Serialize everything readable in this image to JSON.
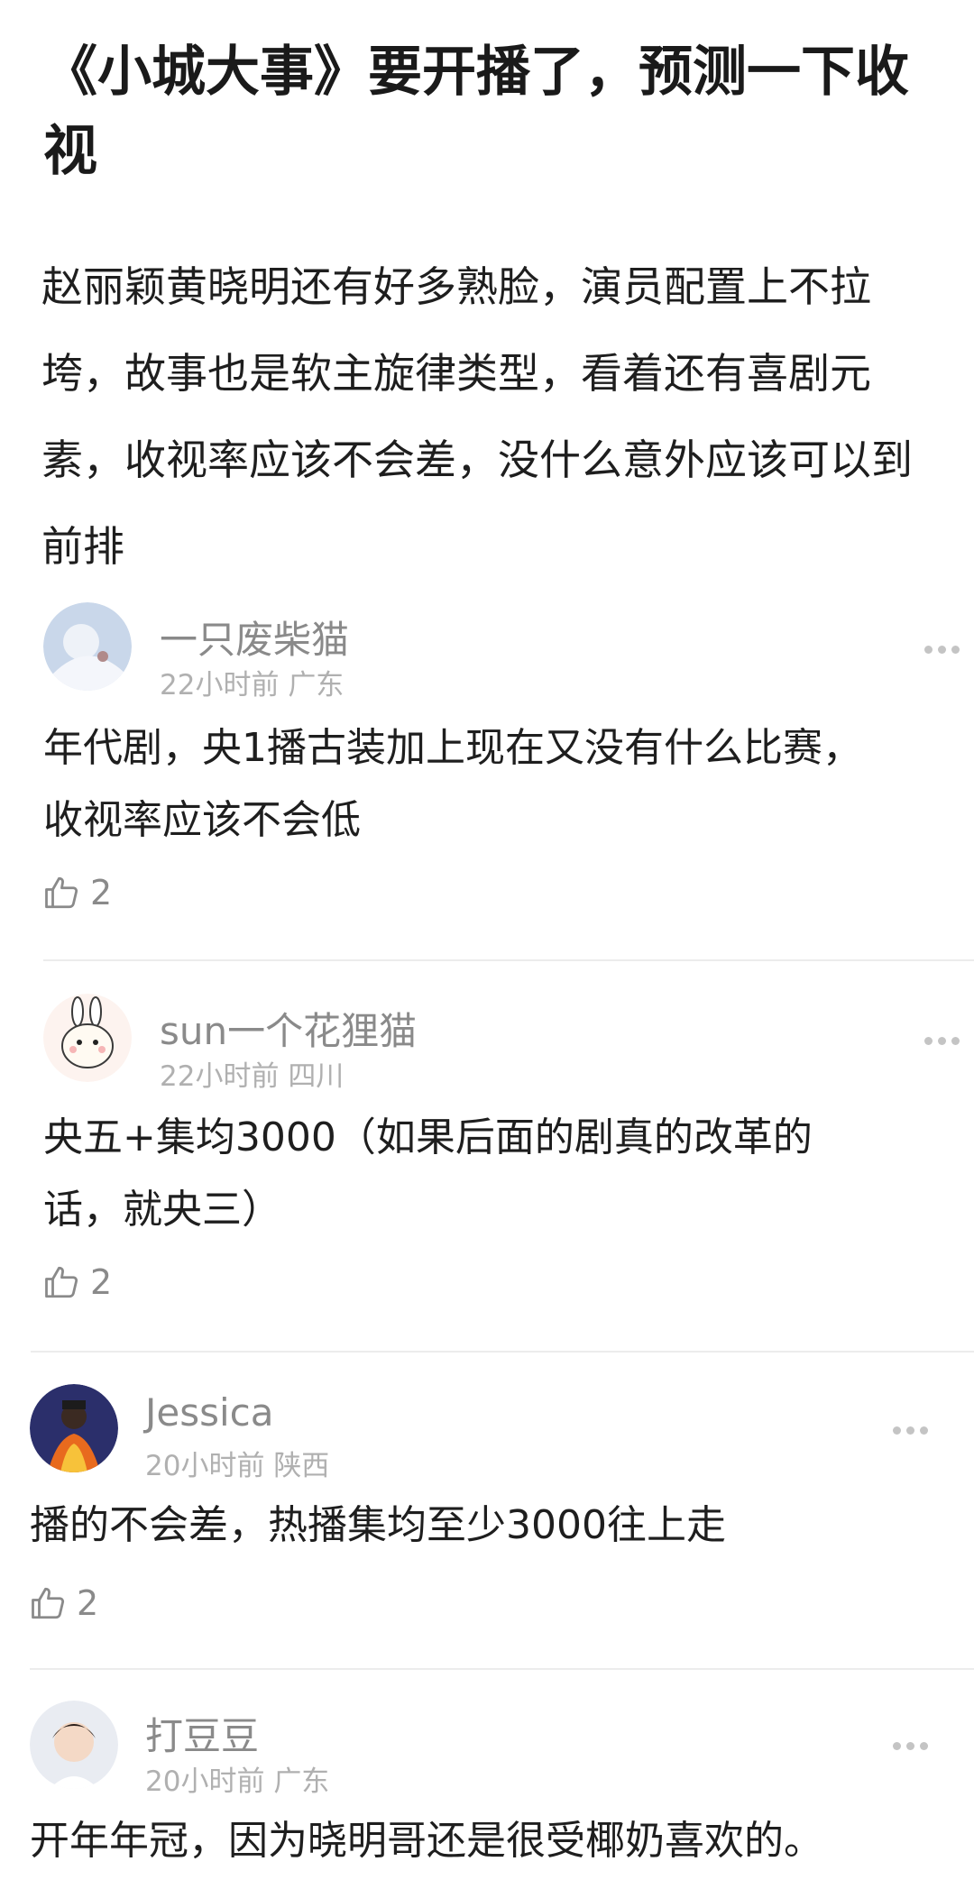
{
  "post": {
    "title": "《小城大事》要开播了，预测一下收视",
    "body": "赵丽颖黄晓明还有好多熟脸，演员配置上不拉垮，故事也是软主旋律类型，看着还有喜剧元素，收视率应该不会差，没什么意外应该可以到前排"
  },
  "comments": [
    {
      "username": "一只废柴猫",
      "time": "22小时前",
      "location": "广东",
      "text": "年代剧，央1播古装加上现在又没有什么比赛，\n收视率应该不会低",
      "likes": "2"
    },
    {
      "username": "sun一个花狸猫",
      "time": "22小时前",
      "location": "四川",
      "text": "央五+集均3000（如果后面的剧真的改革的\n话，就央三）",
      "likes": "2"
    },
    {
      "username": "Jessica",
      "time": "20小时前",
      "location": "陕西",
      "text": "播的不会差，热播集均至少3000往上走",
      "likes": "2"
    },
    {
      "username": "打豆豆",
      "time": "20小时前",
      "location": "广东",
      "text": "开年年冠，因为晓明哥还是很受椰奶喜欢的。",
      "likes": ""
    }
  ]
}
